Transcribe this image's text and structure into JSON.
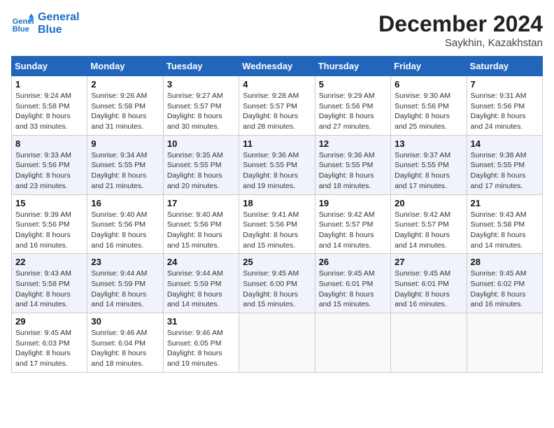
{
  "header": {
    "logo_line1": "General",
    "logo_line2": "Blue",
    "month_title": "December 2024",
    "location": "Saykhin, Kazakhstan"
  },
  "weekdays": [
    "Sunday",
    "Monday",
    "Tuesday",
    "Wednesday",
    "Thursday",
    "Friday",
    "Saturday"
  ],
  "weeks": [
    [
      {
        "day": "1",
        "sunrise": "9:24 AM",
        "sunset": "5:58 PM",
        "daylight": "8 hours and 33 minutes."
      },
      {
        "day": "2",
        "sunrise": "9:26 AM",
        "sunset": "5:58 PM",
        "daylight": "8 hours and 31 minutes."
      },
      {
        "day": "3",
        "sunrise": "9:27 AM",
        "sunset": "5:57 PM",
        "daylight": "8 hours and 30 minutes."
      },
      {
        "day": "4",
        "sunrise": "9:28 AM",
        "sunset": "5:57 PM",
        "daylight": "8 hours and 28 minutes."
      },
      {
        "day": "5",
        "sunrise": "9:29 AM",
        "sunset": "5:56 PM",
        "daylight": "8 hours and 27 minutes."
      },
      {
        "day": "6",
        "sunrise": "9:30 AM",
        "sunset": "5:56 PM",
        "daylight": "8 hours and 25 minutes."
      },
      {
        "day": "7",
        "sunrise": "9:31 AM",
        "sunset": "5:56 PM",
        "daylight": "8 hours and 24 minutes."
      }
    ],
    [
      {
        "day": "8",
        "sunrise": "9:33 AM",
        "sunset": "5:56 PM",
        "daylight": "8 hours and 23 minutes."
      },
      {
        "day": "9",
        "sunrise": "9:34 AM",
        "sunset": "5:55 PM",
        "daylight": "8 hours and 21 minutes."
      },
      {
        "day": "10",
        "sunrise": "9:35 AM",
        "sunset": "5:55 PM",
        "daylight": "8 hours and 20 minutes."
      },
      {
        "day": "11",
        "sunrise": "9:36 AM",
        "sunset": "5:55 PM",
        "daylight": "8 hours and 19 minutes."
      },
      {
        "day": "12",
        "sunrise": "9:36 AM",
        "sunset": "5:55 PM",
        "daylight": "8 hours and 18 minutes."
      },
      {
        "day": "13",
        "sunrise": "9:37 AM",
        "sunset": "5:55 PM",
        "daylight": "8 hours and 17 minutes."
      },
      {
        "day": "14",
        "sunrise": "9:38 AM",
        "sunset": "5:55 PM",
        "daylight": "8 hours and 17 minutes."
      }
    ],
    [
      {
        "day": "15",
        "sunrise": "9:39 AM",
        "sunset": "5:56 PM",
        "daylight": "8 hours and 16 minutes."
      },
      {
        "day": "16",
        "sunrise": "9:40 AM",
        "sunset": "5:56 PM",
        "daylight": "8 hours and 16 minutes."
      },
      {
        "day": "17",
        "sunrise": "9:40 AM",
        "sunset": "5:56 PM",
        "daylight": "8 hours and 15 minutes."
      },
      {
        "day": "18",
        "sunrise": "9:41 AM",
        "sunset": "5:56 PM",
        "daylight": "8 hours and 15 minutes."
      },
      {
        "day": "19",
        "sunrise": "9:42 AM",
        "sunset": "5:57 PM",
        "daylight": "8 hours and 14 minutes."
      },
      {
        "day": "20",
        "sunrise": "9:42 AM",
        "sunset": "5:57 PM",
        "daylight": "8 hours and 14 minutes."
      },
      {
        "day": "21",
        "sunrise": "9:43 AM",
        "sunset": "5:58 PM",
        "daylight": "8 hours and 14 minutes."
      }
    ],
    [
      {
        "day": "22",
        "sunrise": "9:43 AM",
        "sunset": "5:58 PM",
        "daylight": "8 hours and 14 minutes."
      },
      {
        "day": "23",
        "sunrise": "9:44 AM",
        "sunset": "5:59 PM",
        "daylight": "8 hours and 14 minutes."
      },
      {
        "day": "24",
        "sunrise": "9:44 AM",
        "sunset": "5:59 PM",
        "daylight": "8 hours and 14 minutes."
      },
      {
        "day": "25",
        "sunrise": "9:45 AM",
        "sunset": "6:00 PM",
        "daylight": "8 hours and 15 minutes."
      },
      {
        "day": "26",
        "sunrise": "9:45 AM",
        "sunset": "6:01 PM",
        "daylight": "8 hours and 15 minutes."
      },
      {
        "day": "27",
        "sunrise": "9:45 AM",
        "sunset": "6:01 PM",
        "daylight": "8 hours and 16 minutes."
      },
      {
        "day": "28",
        "sunrise": "9:45 AM",
        "sunset": "6:02 PM",
        "daylight": "8 hours and 16 minutes."
      }
    ],
    [
      {
        "day": "29",
        "sunrise": "9:45 AM",
        "sunset": "6:03 PM",
        "daylight": "8 hours and 17 minutes."
      },
      {
        "day": "30",
        "sunrise": "9:46 AM",
        "sunset": "6:04 PM",
        "daylight": "8 hours and 18 minutes."
      },
      {
        "day": "31",
        "sunrise": "9:46 AM",
        "sunset": "6:05 PM",
        "daylight": "8 hours and 19 minutes."
      },
      null,
      null,
      null,
      null
    ]
  ],
  "labels": {
    "sunrise": "Sunrise:",
    "sunset": "Sunset:",
    "daylight": "Daylight:"
  }
}
